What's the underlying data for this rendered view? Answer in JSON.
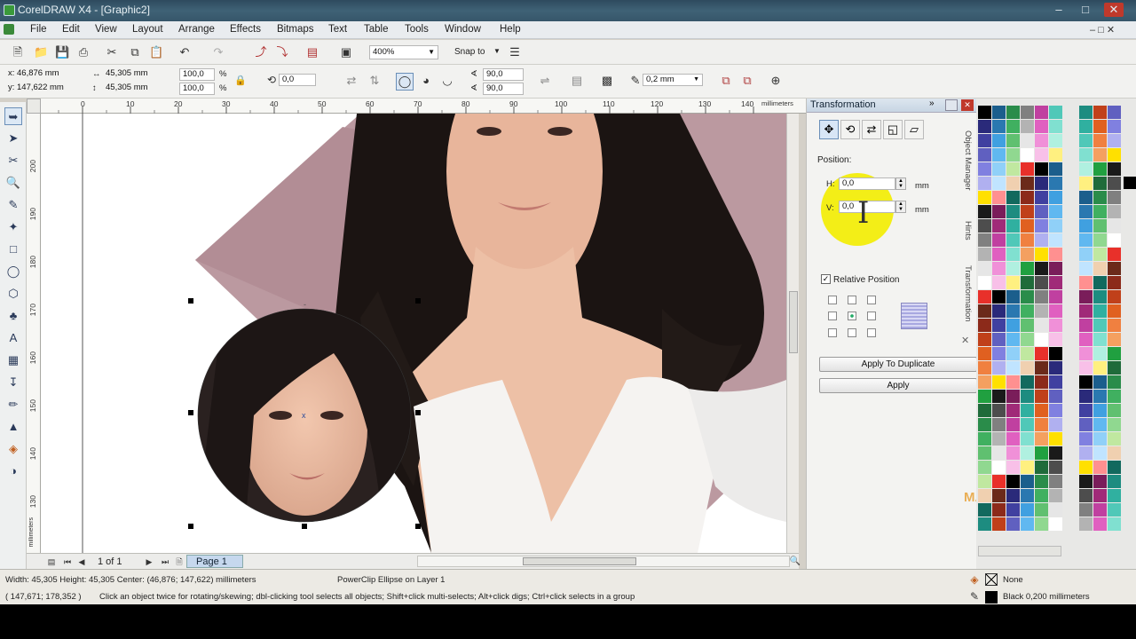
{
  "window": {
    "title": "CorelDRAW X4 - [Graphic2]"
  },
  "menu": [
    "File",
    "Edit",
    "View",
    "Layout",
    "Arrange",
    "Effects",
    "Bitmaps",
    "Text",
    "Table",
    "Tools",
    "Window",
    "Help"
  ],
  "std_toolbar": {
    "zoom": "400%",
    "snap_to": "Snap to"
  },
  "prop_bar": {
    "x": "x: 46,876 mm",
    "y": "y: 147,622 mm",
    "w": "45,305 mm",
    "h": "45,305 mm",
    "scale_x": "100,0",
    "scale_y": "100,0",
    "pct": "%",
    "rotation": "0,0",
    "angle1": "90,0",
    "angle2": "90,0",
    "outline_width": "0,2 mm"
  },
  "ruler": {
    "h_ticks": [
      "0",
      "10",
      "20",
      "30",
      "40",
      "50",
      "60",
      "70",
      "80",
      "90",
      "100",
      "110",
      "120",
      "130",
      "140"
    ],
    "h_unit": "millimeters",
    "v_ticks": [
      "200",
      "190",
      "180",
      "170",
      "160",
      "150",
      "140",
      "130"
    ],
    "v_unit": "millimeters"
  },
  "pagenav": {
    "page_count": "1 of 1",
    "page_tab": "Page 1"
  },
  "docker": {
    "title": "Transformation",
    "position_label": "Position:",
    "h_label": "H:",
    "h_value": "0,0",
    "h_unit": "mm",
    "v_label": "V:",
    "v_value": "0,0",
    "v_unit": "mm",
    "relative_label": "Relative Position",
    "apply_dup": "Apply To Duplicate",
    "apply": "Apply"
  },
  "vtabs": [
    "Object Manager",
    "Hints",
    "Transformation"
  ],
  "watermark": "MAKEup",
  "status": {
    "dims": "Width: 45,305  Height: 45,305  Center: (46,876; 147,622)  millimeters",
    "object": "PowerClip Ellipse on Layer 1",
    "coords": "( 147,671; 178,352 )",
    "hint": "Click an object twice for rotating/skewing; dbl-clicking tool selects all objects; Shift+click multi-selects; Alt+click digs; Ctrl+click selects in a group",
    "fill": "None",
    "outline": "Black  0,200 millimeters"
  },
  "palette_colors": [
    "#000000",
    "#1a1a1a",
    "#6b2a1a",
    "#1f6b3a",
    "#12695e",
    "#1b5e8c",
    "#7a1d5a",
    "#2a2a7a",
    "#4d4d4d",
    "#8c2a1a",
    "#2a8c4a",
    "#1d8c80",
    "#2a78b0",
    "#a02a78",
    "#4040a0",
    "#808080",
    "#c0401a",
    "#40b060",
    "#30b0a0",
    "#40a0e0",
    "#c040a0",
    "#6060c0",
    "#b3b3b3",
    "#e06020",
    "#60c070",
    "#50c8b8",
    "#60b8f0",
    "#e060c0",
    "#8080e0",
    "#e6e6e6",
    "#f08040",
    "#90d890",
    "#80e0d0",
    "#90d0f8",
    "#f090d8",
    "#b0b0f0",
    "#ffffff",
    "#f4a060",
    "#c0e8a0",
    "#b0f0e0",
    "#c0e4ff",
    "#f8c0e8",
    "#ffe000",
    "#e8302a",
    "#20a040",
    "#f0d0b0",
    "#fff080",
    "#ff9090"
  ]
}
